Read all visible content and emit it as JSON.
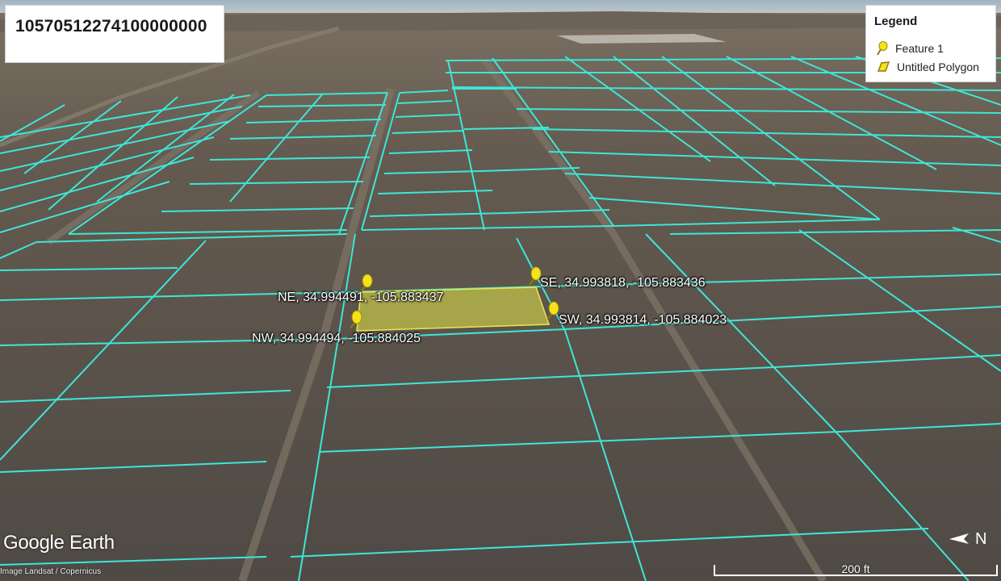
{
  "map": {
    "title": "10570512274100000000",
    "legend": {
      "title": "Legend",
      "items": [
        {
          "label": "Feature 1",
          "icon": "pushpin-icon"
        },
        {
          "label": "Untitled Polygon",
          "icon": "polygon-icon"
        }
      ]
    },
    "pins": [
      {
        "id": "ne",
        "label": "NE, 34.994491, -105.883437"
      },
      {
        "id": "se",
        "label": "SE, 34.993818, -105.883436"
      },
      {
        "id": "sw",
        "label": "SW, 34.993814, -105.884023"
      },
      {
        "id": "nw",
        "label": "NW, 34.994494, -105.884025"
      }
    ],
    "brand": "Google Earth",
    "imagery_credit": "Image Landsat / Copernicus",
    "compass_label": "N",
    "scale_label": "200 ft",
    "colors": {
      "grid": "#3ee6d8",
      "polygon_fill": "#c8c84a",
      "pin": "#f5e21a",
      "ground": "#5a5248",
      "sky": "#a9bcc9"
    }
  }
}
